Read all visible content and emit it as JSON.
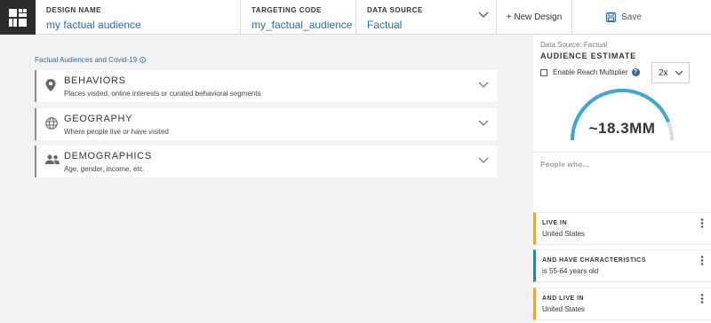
{
  "header": {
    "design_name_label": "DESIGN NAME",
    "design_name_value": "my factual audience",
    "targeting_code_label": "TARGETING CODE",
    "targeting_code_value": "my_factual_audience",
    "data_source_label": "DATA SOURCE",
    "data_source_value": "Factual",
    "new_design_label": "+ New Design",
    "save_label": "Save"
  },
  "main": {
    "covid_link": "Factual Audiences and Covid-19",
    "categories": [
      {
        "title": "BEHAVIORS",
        "description": "Places visited, online interests or curated behavioral segments",
        "icon": "location-pin-icon"
      },
      {
        "title": "GEOGRAPHY",
        "description": "Where people live or have visited",
        "icon": "globe-icon"
      },
      {
        "title": "DEMOGRAPHICS",
        "description": "Age, gender, income, etc.",
        "icon": "people-icon"
      }
    ]
  },
  "panel": {
    "data_source": "Data Source: Factual",
    "title": "AUDIENCE ESTIMATE",
    "reach_multiplier_label": "Enable Reach Multiplier",
    "multiplier_value": "2x",
    "estimate": "~18.3MM",
    "gauge_fill_fraction": 0.88,
    "people_who": "People who...",
    "rules": [
      {
        "title": "LIVE IN",
        "value": "United States"
      },
      {
        "title": "AND HAVE CHARACTERISTICS",
        "value": "is 55-64 years old"
      },
      {
        "title": "AND LIVE IN",
        "value": "United States"
      }
    ]
  },
  "colors": {
    "accent": "#2b6aa3",
    "gauge": "#3ea6cf",
    "rule_orange": "#e8a33d",
    "rule_blue": "#2b7fbf"
  }
}
